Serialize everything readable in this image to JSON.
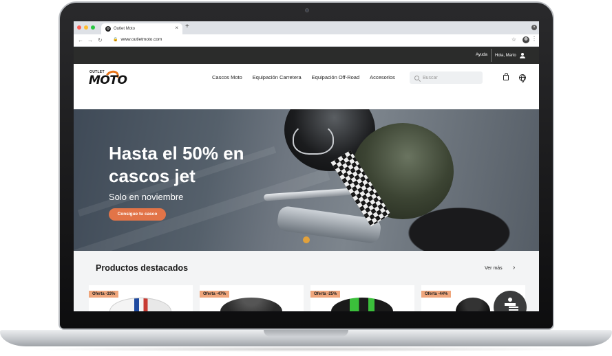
{
  "browser": {
    "tab_title": "Outlet Moto",
    "url": "www.outletmoto.com",
    "new_tab": "+",
    "tab_close": "×",
    "win_close": "×"
  },
  "topbar": {
    "help": "Ayuda",
    "greeting": "Hola, Mario"
  },
  "header": {
    "logo_small": "OUTLET",
    "logo_big": "MOTO",
    "nav": [
      "Cascos Moto",
      "Equipación Carretera",
      "Equipación Off-Road",
      "Accesorios"
    ],
    "search_placeholder": "Buscar"
  },
  "hero": {
    "title": "Hasta el 50% en cascos jet",
    "subtitle": "Solo en noviembre",
    "cta": "Consigue tu casco"
  },
  "featured": {
    "title": "Productos destacados",
    "see_more": "Ver más",
    "cards": [
      {
        "badge": "Oferta -33%"
      },
      {
        "badge": "Oferta -47%"
      },
      {
        "badge": "Oferta -25%"
      },
      {
        "badge": "Oferta -44%"
      }
    ]
  },
  "colors": {
    "accent": "#e27448",
    "badge": "#efa67c",
    "topbar": "#2b2c2b"
  },
  "icons": [
    "user-icon",
    "search-icon",
    "bag-icon",
    "globe-icon",
    "accessibility-icon",
    "star-icon",
    "lock-icon"
  ]
}
